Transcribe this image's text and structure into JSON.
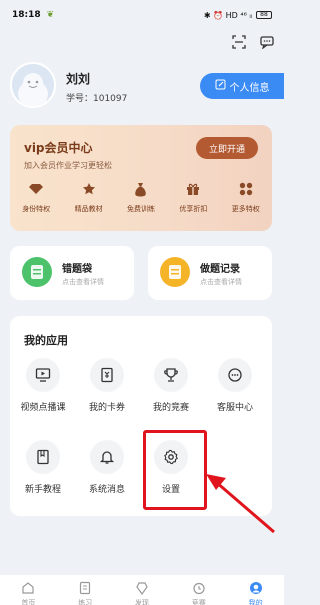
{
  "status_bar": {
    "time": "18:18",
    "icons_right": "✱ ⏰ HD ⁴⁶ ₗₗ",
    "battery": "88"
  },
  "profile": {
    "name": "刘刘",
    "student_id": "学号：101097",
    "info_button": "个人信息"
  },
  "vip": {
    "title": "vip会员中心",
    "subtitle": "加入会员作业学习更轻松",
    "open_button": "立即开通",
    "features": [
      {
        "label": "身份特权",
        "icon": "diamond-icon"
      },
      {
        "label": "精品教材",
        "icon": "star-icon"
      },
      {
        "label": "免费训练",
        "icon": "money-bag-icon"
      },
      {
        "label": "优享折扣",
        "icon": "gift-icon"
      },
      {
        "label": "更多特权",
        "icon": "grid-icon"
      }
    ]
  },
  "quick": [
    {
      "title": "错题袋",
      "subtitle": "点击查看详情",
      "icon": "mistake-bag-icon",
      "color": "#4cc36b"
    },
    {
      "title": "做题记录",
      "subtitle": "点击查看详情",
      "icon": "record-icon",
      "color": "#f5b428"
    }
  ],
  "apps": {
    "title": "我的应用",
    "items": [
      {
        "label": "视频点播课",
        "icon": "video-icon"
      },
      {
        "label": "我的卡券",
        "icon": "coupon-icon"
      },
      {
        "label": "我的竞赛",
        "icon": "trophy-icon"
      },
      {
        "label": "客服中心",
        "icon": "chat-icon"
      },
      {
        "label": "新手教程",
        "icon": "book-icon"
      },
      {
        "label": "系统消息",
        "icon": "bell-icon"
      },
      {
        "label": "设置",
        "icon": "gear-icon"
      }
    ]
  },
  "bottom_nav": [
    {
      "label": "首页",
      "icon": "home-icon"
    },
    {
      "label": "练习",
      "icon": "practice-icon"
    },
    {
      "label": "发现",
      "icon": "discover-icon"
    },
    {
      "label": "竞赛",
      "icon": "clock-icon"
    },
    {
      "label": "我的",
      "icon": "profile-icon",
      "active": true
    }
  ],
  "colors": {
    "accent": "#3b8bf5",
    "vip_button": "#b45a33",
    "highlight": "#e0141c"
  }
}
